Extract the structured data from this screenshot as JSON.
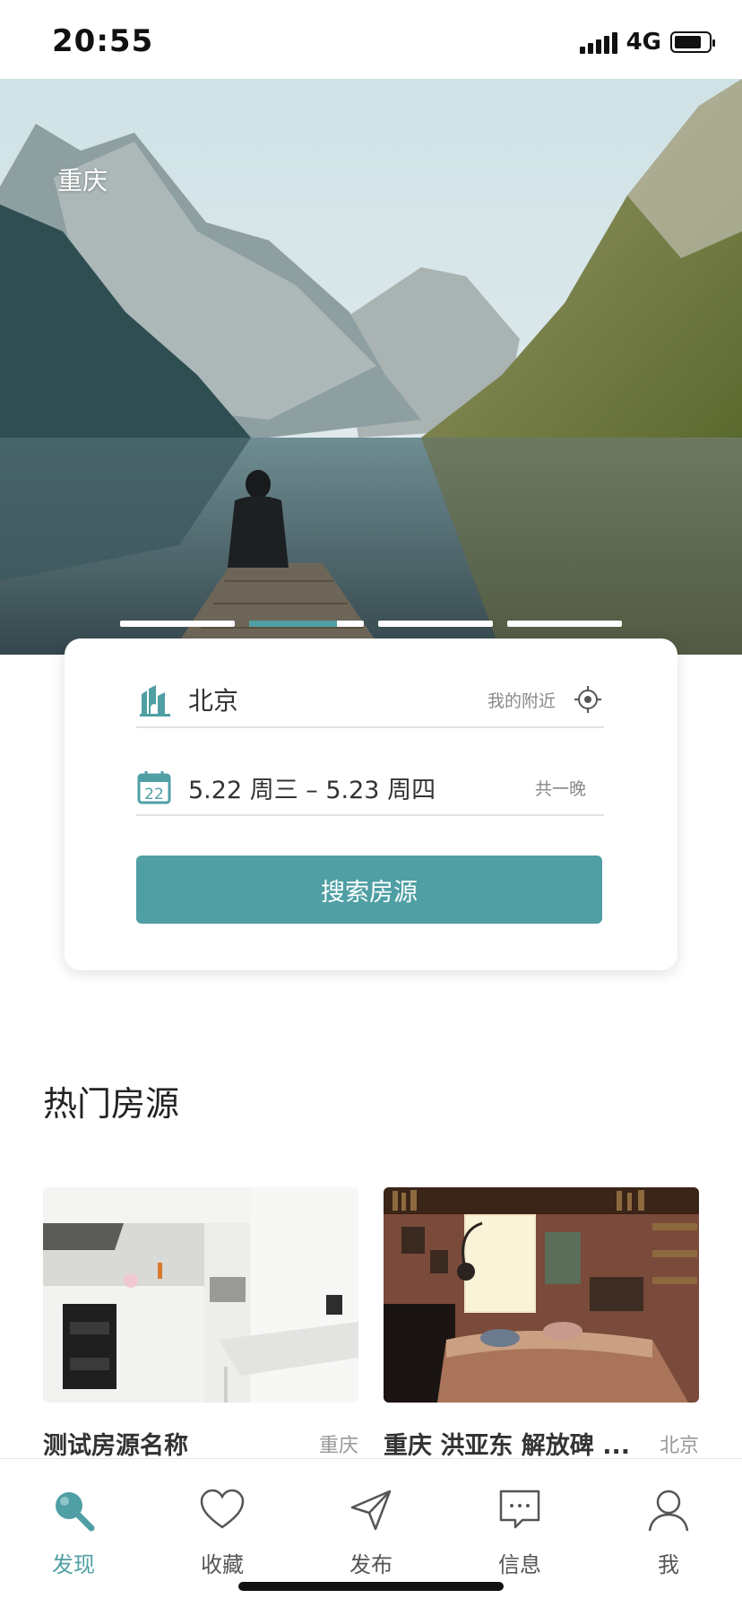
{
  "status_bar": {
    "time": "20:55",
    "network": "4G",
    "battery_level": 0.8
  },
  "hero": {
    "city_label": "重庆",
    "carousel": {
      "count": 4,
      "active_index": 1
    },
    "image": "mountain-lake-with-person-on-pier"
  },
  "search": {
    "city": "北京",
    "nearby_label": "我的附近",
    "date_range": "5.22 周三 – 5.23 周四",
    "nights": "共一晚",
    "calendar_day": "22",
    "button_label": "搜索房源"
  },
  "hot": {
    "title": "热门房源",
    "listings": [
      {
        "name": "测试房源名称",
        "city": "重庆",
        "image": "kitchen-interior"
      },
      {
        "name": "重庆 洪亚东 解放碑 ...",
        "city": "北京",
        "image": "bedroom-with-bookshelves"
      }
    ]
  },
  "tabbar": {
    "items": [
      {
        "label": "发现",
        "icon": "search-icon",
        "active": true
      },
      {
        "label": "收藏",
        "icon": "heart-icon",
        "active": false
      },
      {
        "label": "发布",
        "icon": "send-icon",
        "active": false
      },
      {
        "label": "信息",
        "icon": "message-icon",
        "active": false
      },
      {
        "label": "我",
        "icon": "user-icon",
        "active": false
      }
    ]
  },
  "colors": {
    "accent": "#4f9fa4",
    "text": "#333333",
    "muted": "#888888"
  }
}
